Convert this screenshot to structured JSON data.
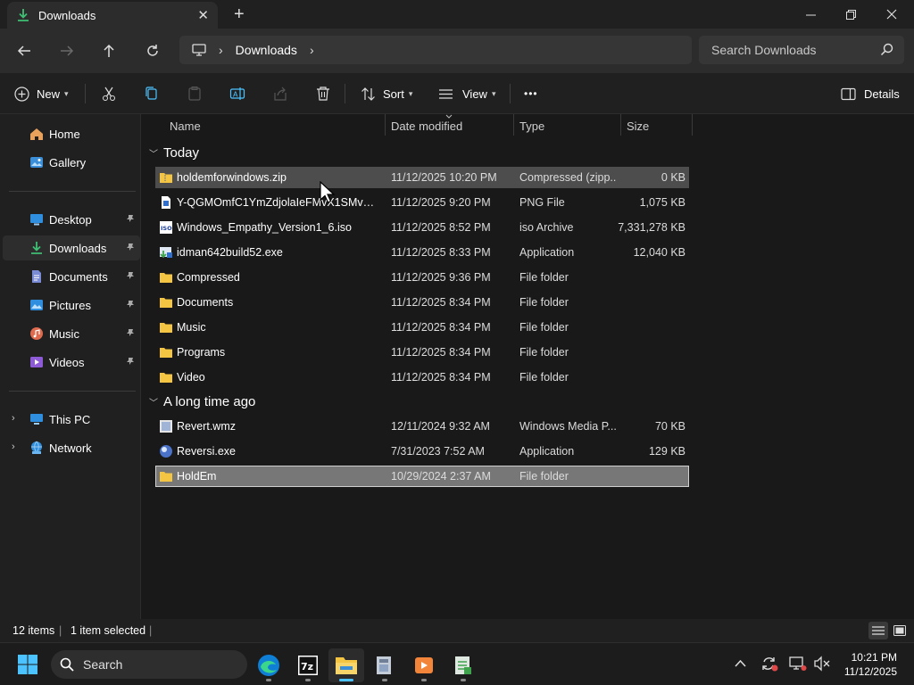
{
  "window": {
    "tab_title": "Downloads",
    "tab_close": "✕",
    "new_tab": "+"
  },
  "address": {
    "crumb": "Downloads",
    "search_placeholder": "Search Downloads"
  },
  "toolbar": {
    "new_label": "New",
    "sort_label": "Sort",
    "view_label": "View",
    "more_label": "•••",
    "details_label": "Details"
  },
  "sidebar": {
    "items": [
      {
        "label": "Home",
        "icon": "home-icon",
        "pinned": false
      },
      {
        "label": "Gallery",
        "icon": "gallery-icon",
        "pinned": false
      },
      {
        "label": "Desktop",
        "icon": "desktop-icon",
        "pinned": true
      },
      {
        "label": "Downloads",
        "icon": "download-icon",
        "pinned": true,
        "active": true
      },
      {
        "label": "Documents",
        "icon": "documents-icon",
        "pinned": true
      },
      {
        "label": "Pictures",
        "icon": "pictures-icon",
        "pinned": true
      },
      {
        "label": "Music",
        "icon": "music-icon",
        "pinned": true
      },
      {
        "label": "Videos",
        "icon": "videos-icon",
        "pinned": true
      },
      {
        "label": "This PC",
        "icon": "this-pc-icon",
        "expandable": true
      },
      {
        "label": "Network",
        "icon": "network-icon",
        "expandable": true
      }
    ]
  },
  "columns": {
    "name": "Name",
    "date": "Date modified",
    "type": "Type",
    "size": "Size"
  },
  "groups": [
    {
      "label": "Today",
      "files": [
        {
          "name": "holdemforwindows.zip",
          "date": "11/12/2025 10:20 PM",
          "type": "Compressed (zipp...",
          "size": "0 KB",
          "icon": "zip-folder-icon",
          "state": "hover"
        },
        {
          "name": "Y-QGMOmfC1YmZdjolaIeFMvX1SMvkjJ...",
          "date": "11/12/2025 9:20 PM",
          "type": "PNG File",
          "size": "1,075 KB",
          "icon": "png-file-icon"
        },
        {
          "name": "Windows_Empathy_Version1_6.iso",
          "date": "11/12/2025 8:52 PM",
          "type": "iso Archive",
          "size": "7,331,278 KB",
          "icon": "iso-file-icon"
        },
        {
          "name": "idman642build52.exe",
          "date": "11/12/2025 8:33 PM",
          "type": "Application",
          "size": "12,040 KB",
          "icon": "exe-file-icon"
        },
        {
          "name": "Compressed",
          "date": "11/12/2025 9:36 PM",
          "type": "File folder",
          "size": "",
          "icon": "folder-icon"
        },
        {
          "name": "Documents",
          "date": "11/12/2025 8:34 PM",
          "type": "File folder",
          "size": "",
          "icon": "folder-icon"
        },
        {
          "name": "Music",
          "date": "11/12/2025 8:34 PM",
          "type": "File folder",
          "size": "",
          "icon": "folder-icon"
        },
        {
          "name": "Programs",
          "date": "11/12/2025 8:34 PM",
          "type": "File folder",
          "size": "",
          "icon": "folder-icon"
        },
        {
          "name": "Video",
          "date": "11/12/2025 8:34 PM",
          "type": "File folder",
          "size": "",
          "icon": "folder-icon"
        }
      ]
    },
    {
      "label": "A long time ago",
      "files": [
        {
          "name": "Revert.wmz",
          "date": "12/11/2024 9:32 AM",
          "type": "Windows Media P...",
          "size": "70 KB",
          "icon": "wmz-file-icon"
        },
        {
          "name": "Reversi.exe",
          "date": "7/31/2023 7:52 AM",
          "type": "Application",
          "size": "129 KB",
          "icon": "reversi-app-icon"
        },
        {
          "name": "HoldEm",
          "date": "10/29/2024 2:37 AM",
          "type": "File folder",
          "size": "",
          "icon": "folder-icon",
          "state": "selected"
        }
      ]
    }
  ],
  "status": {
    "count": "12 items",
    "selection": "1 item selected"
  },
  "taskbar": {
    "search_label": "Search",
    "apps": [
      "edge-icon",
      "7zip-icon",
      "file-explorer-icon",
      "app-installer-icon",
      "media-player-icon",
      "notepad-icon"
    ]
  },
  "clock": {
    "time": "10:21 PM",
    "date": "11/12/2025"
  },
  "colors": {
    "accent": "#4cc2ff",
    "folder": "#f4c542",
    "download": "#3fbf74"
  }
}
